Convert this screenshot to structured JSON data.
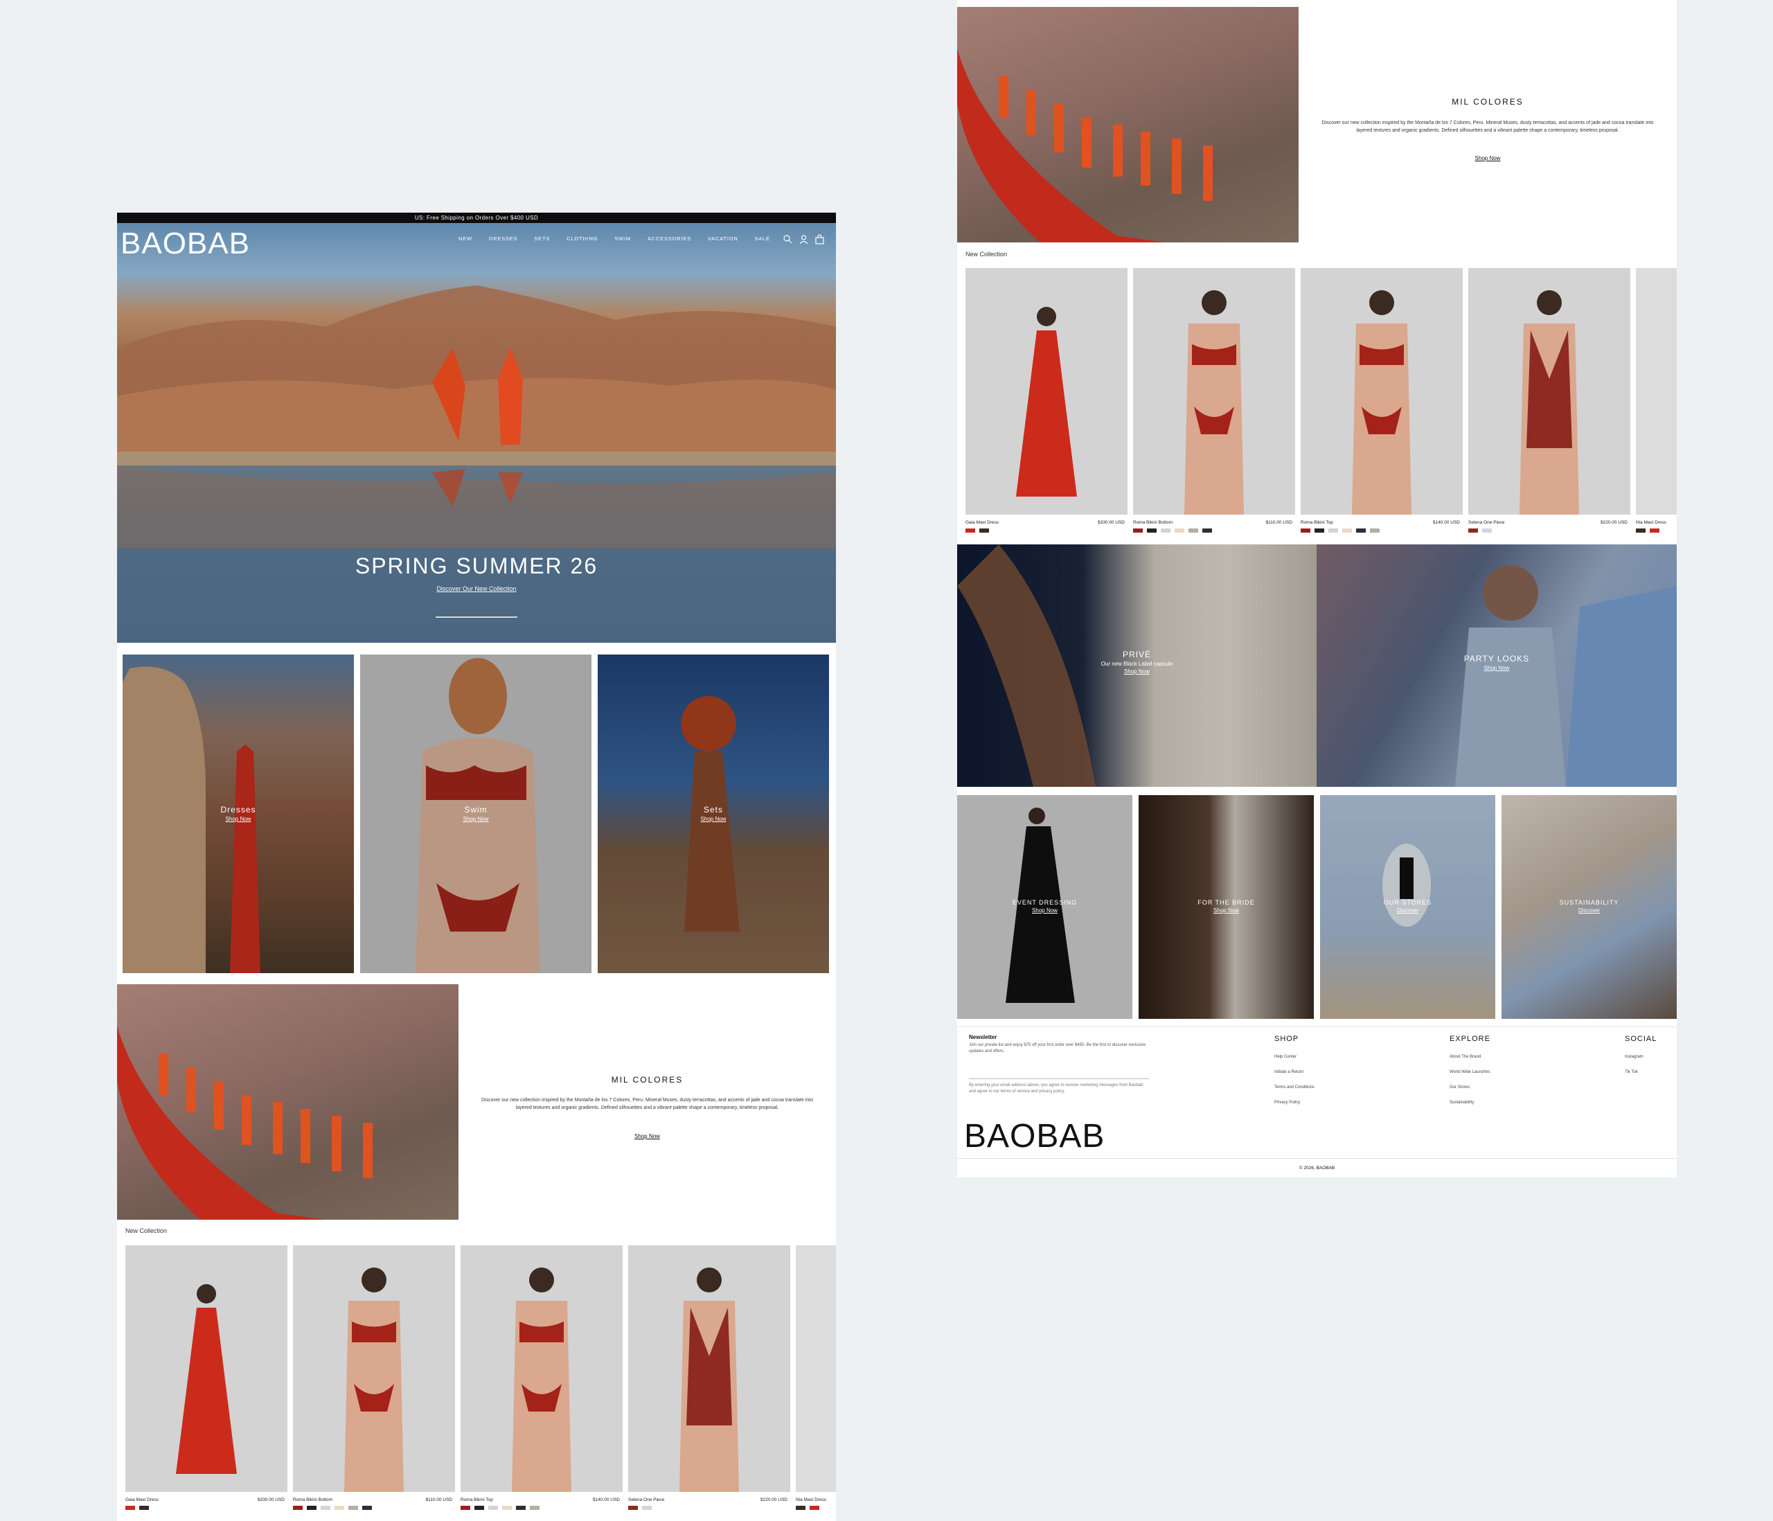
{
  "announcement": "US: Free Shipping on Orders Over $400 USD",
  "brand": "BAOBAB",
  "nav": [
    "NEW",
    "DRESSES",
    "SETS",
    "CLOTHING",
    "SWIM",
    "ACCESSORIES",
    "VACATION",
    "SALE"
  ],
  "header_icons": [
    "search-icon",
    "account-icon",
    "bag-icon"
  ],
  "hero": {
    "title": "SPRING SUMMER 26",
    "link": "Discover Our New Collection"
  },
  "category_tiles": [
    {
      "title": "Dresses",
      "link": "Shop Now"
    },
    {
      "title": "Swim",
      "link": "Shop Now"
    },
    {
      "title": "Sets",
      "link": "Shop Now"
    }
  ],
  "mil_colores": {
    "title": "MIL COLORES",
    "description": "Discover our new collection inspired by the Montaña de los 7 Colores, Peru. Mineral Muses, dusty terracottas, and accents of jade and cocoa translate into layered textures and organic gradients. Defined silhouettes and a vibrant palette shape a contemporary, timeless proposal.",
    "link": "Shop Now"
  },
  "new_collection": {
    "heading": "New Collection",
    "products": [
      {
        "name": "Gaia Maxi Dress",
        "price": "$330.00 USD",
        "swatches": [
          "#c8291f",
          "#3a2a22"
        ]
      },
      {
        "name": "Roma Bikini Bottom",
        "price": "$110.00 USD",
        "swatches": [
          "#9b1e1e",
          "#222222",
          "#d4d4d4",
          "#e8dcc0",
          "#b5aea2",
          "#2d2f35"
        ]
      },
      {
        "name": "Roma Bikini Top",
        "price": "$140.00 USD",
        "swatches": [
          "#9b1e1e",
          "#222222",
          "#d4d4d4",
          "#e8dcc0",
          "#2d2f35",
          "#b5aea2"
        ]
      },
      {
        "name": "Selena One Piece",
        "price": "$220.00 USD",
        "swatches": [
          "#8e2a22",
          "#cfd6df"
        ]
      },
      {
        "name": "Nia Maxi Dress",
        "price": "",
        "swatches": [
          "#3a2a22",
          "#c8291f"
        ]
      }
    ]
  },
  "feature_banners": [
    {
      "title": "PRIVÉ",
      "subtitle": "Our new Black Label capsule",
      "link": "Shop Now"
    },
    {
      "title": "PARTY LOOKS",
      "subtitle": "",
      "link": "Shop Now"
    }
  ],
  "story_tiles": [
    {
      "title": "EVENT DRESSING",
      "link": "Shop Now"
    },
    {
      "title": "FOR THE BRIDE",
      "link": "Shop Now"
    },
    {
      "title": "OUR STORES",
      "link": "Discover"
    },
    {
      "title": "SUSTAINABILITY",
      "link": "Discover"
    }
  ],
  "footer": {
    "newsletter_title": "Newsletter",
    "newsletter_text": "Join our private list and enjoy $75 off your first order over $450. Be the first to discover exclusive updates and offers.",
    "consent": "By entering your email address above, you agree to receive marketing messages from Baobab and agree to our terms of service and privacy policy.",
    "columns": [
      {
        "title": "SHOP",
        "links": [
          "Help Center",
          "Initiate a Return",
          "Terms and Conditions",
          "Privacy Policy"
        ]
      },
      {
        "title": "EXPLORE",
        "links": [
          "About The Brand",
          "World Wide Launches",
          "Our Stores",
          "Sustainability"
        ]
      },
      {
        "title": "SOCIAL",
        "links": [
          "Instagram",
          "Tik Tok"
        ]
      }
    ],
    "copyright": "© 2026, BAOBAB"
  },
  "colors": {
    "announce_bg": "#0d0d0d",
    "accent_red": "#c8291f",
    "page_bg": "#eef1f3"
  }
}
